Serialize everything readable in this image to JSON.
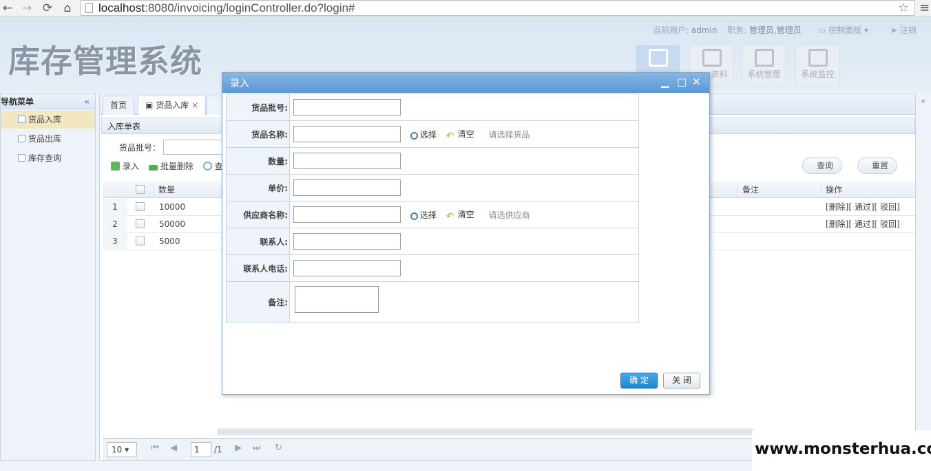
{
  "browser": {
    "back": "←",
    "forward": "→",
    "reload": "⟳",
    "home": "⌂",
    "url_host": "localhost",
    "url_rest": ":8080/invoicing/loginController.do?login#",
    "star": "☆",
    "menu": "≡"
  },
  "header": {
    "title": "库存管理系统",
    "current_user_label": "当前用户:",
    "current_user": "admin",
    "role_label": "职务:",
    "role": "管理员,管理员",
    "control_panel": "控制面板",
    "logout": "注销",
    "tiles": [
      {
        "label": ""
      },
      {
        "label": "资料"
      },
      {
        "label": "系统管理"
      },
      {
        "label": "系统监控"
      }
    ]
  },
  "sidebar": {
    "title": "导航菜单",
    "collapse": "«",
    "items": [
      {
        "label": "货品入库"
      },
      {
        "label": "货品出库"
      },
      {
        "label": "库存查询"
      }
    ]
  },
  "main": {
    "tabs": [
      {
        "label": "首页"
      },
      {
        "label": "货品入库",
        "close": "×"
      },
      {
        "label": ""
      }
    ],
    "panel_title": "入库单表",
    "search_label": "货品批号：",
    "toolbar": {
      "add": "录入",
      "batch_delete": "批量删除",
      "query_short": "查",
      "query": "查询",
      "reset": "重置"
    },
    "columns": {
      "quantity": "数量",
      "remark": "备注",
      "operation": "操作"
    },
    "rows": [
      {
        "num": "1",
        "quantity": "10000",
        "ops": "[删除][ 通过][ 驳回]"
      },
      {
        "num": "2",
        "quantity": "50000",
        "ops": "[删除][ 通过][ 驳回]"
      },
      {
        "num": "3",
        "quantity": "5000",
        "ops": ""
      }
    ],
    "pager": {
      "page_size": "10 ▾",
      "first": "⏮",
      "prev": "◀",
      "page": "1",
      "total": "/1",
      "next": "▶",
      "last": "⏭",
      "refresh": "↻"
    }
  },
  "right_collapse": "«",
  "dialog": {
    "title": "录入",
    "minimize": "▁",
    "maximize": "□",
    "close": "✕",
    "fields": [
      {
        "label": "货品批号:"
      },
      {
        "label": "货品名称:",
        "select": "选择",
        "clear": "清空",
        "hint": "请选择货品"
      },
      {
        "label": "数量:"
      },
      {
        "label": "单价:"
      },
      {
        "label": "供应商名称:",
        "select": "选择",
        "clear": "清空",
        "hint": "请选供应商"
      },
      {
        "label": "联系人:"
      },
      {
        "label": "联系人电话:"
      },
      {
        "label": "备注:"
      }
    ],
    "ok": "确 定",
    "cancel": "关 闭"
  },
  "watermark": "www.monsterhua.com"
}
